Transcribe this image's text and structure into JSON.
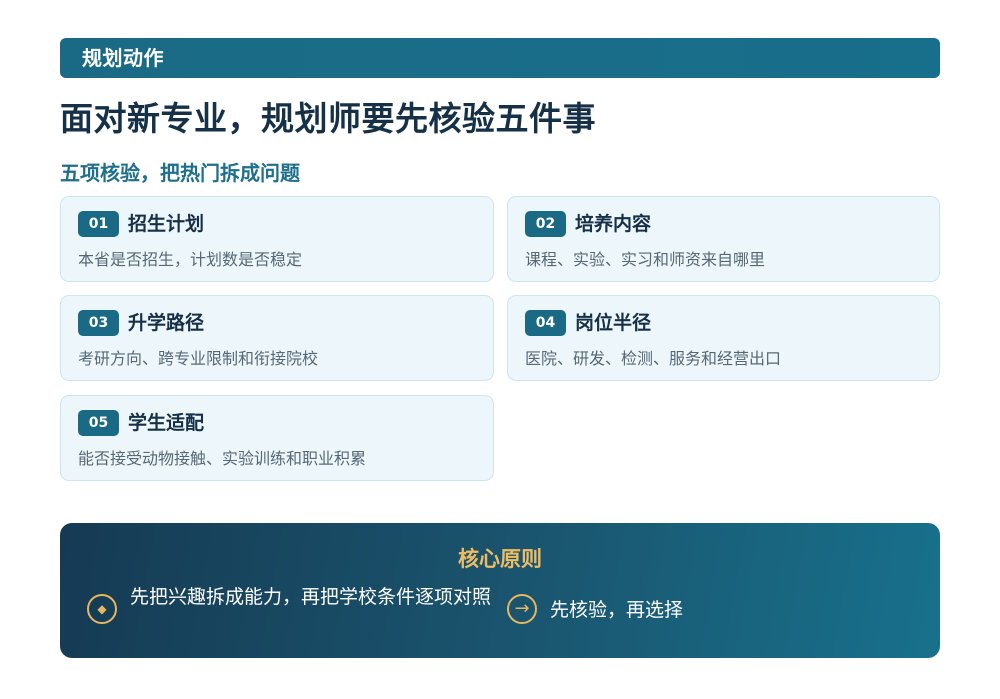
{
  "header": {
    "section_tag": "规划动作",
    "title": "面对新专业，规划师要先核验五件事",
    "subtitle": "五项核验，把热门拆成问题"
  },
  "checks": [
    {
      "num": "01",
      "title": "招生计划",
      "desc": "本省是否招生，计划数是否稳定"
    },
    {
      "num": "02",
      "title": "培养内容",
      "desc": "课程、实验、实习和师资来自哪里"
    },
    {
      "num": "03",
      "title": "升学路径",
      "desc": "考研方向、跨专业限制和衔接院校"
    },
    {
      "num": "04",
      "title": "岗位半径",
      "desc": "医院、研发、检测、服务和经营出口"
    },
    {
      "num": "05",
      "title": "学生适配",
      "desc": "能否接受动物接触、实验训练和职业积累"
    }
  ],
  "principle": {
    "title": "核心原则",
    "items": [
      {
        "icon": "diamond-icon",
        "glyph": "◆",
        "text": "先把兴趣拆成能力，再把学校条件逐项对照"
      },
      {
        "icon": "arrow-right-icon",
        "glyph": "→",
        "text": "先核验，再选择"
      }
    ]
  },
  "colors": {
    "primary": "#1b6a85",
    "accent_gold": "#eebc62",
    "card_bg": "#edf6fa",
    "title_text": "#153047"
  }
}
